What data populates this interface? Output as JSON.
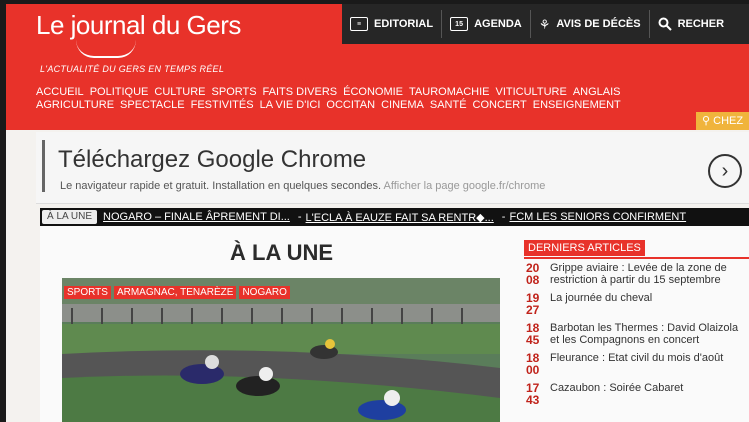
{
  "header": {
    "logo": "Le journal du Gers",
    "tagline": "L'ACTUALITÉ DU GERS EN TEMPS RÉEL",
    "topbar": [
      {
        "label": "EDITORIAL",
        "icon": "newspaper-icon"
      },
      {
        "label": "AGENDA",
        "icon": "calendar-icon",
        "icon_text": "15"
      },
      {
        "label": "AVIS DE DÉCÈS",
        "icon": "flower-icon"
      },
      {
        "label": "RECHER",
        "icon": "search-icon"
      }
    ],
    "nav_row1": [
      "ACCUEIL",
      "POLITIQUE",
      "CULTURE",
      "SPORTS",
      "FAITS DIVERS",
      "ÉCONOMIE",
      "TAUROMACHIE",
      "VITICULTURE",
      "ANGLAIS"
    ],
    "nav_row2": [
      "AGRICULTURE",
      "SPECTACLE",
      "FESTIVITÉS",
      "LA VIE D'ICI",
      "OCCITAN",
      "CINEMA",
      "SANTÉ",
      "CONCERT",
      "ENSEIGNEMENT"
    ],
    "chez": "CHEZ"
  },
  "promo": {
    "title": "Téléchargez Google Chrome",
    "subtitle": "Le navigateur rapide et gratuit. Installation en quelques secondes.",
    "link": "Afficher la page google.fr/chrome"
  },
  "ticker": {
    "label": "À LA UNE",
    "items": [
      "NOGARO – FINALE ÂPREMENT DI...",
      "L'ECLA À EAUZE FAIT SA RENTR◆...",
      "FCM LES SENIORS CONFIRMENT"
    ]
  },
  "main": {
    "title": "À LA UNE",
    "tags": [
      "SPORTS",
      "ARMAGNAC, TENARÈZE",
      "NOGARO"
    ]
  },
  "side": {
    "heading": "DERNIERS ARTICLES",
    "articles": [
      {
        "day": "20",
        "time": "08",
        "title": "Grippe aviaire : Levée de la zone de restriction à partir du 15 septembre"
      },
      {
        "day": "19",
        "time": "27",
        "title": "La journée du cheval"
      },
      {
        "day": "18",
        "time": "45",
        "title": "Barbotan les Thermes : David Olaizola et les Compagnons en concert"
      },
      {
        "day": "18",
        "time": "00",
        "title": "Fleurance : Etat civil du mois d'août"
      },
      {
        "day": "17",
        "time": "43",
        "title": "Cazaubon : Soirée Cabaret"
      }
    ]
  },
  "colors": {
    "brand_red": "#e8322a",
    "topbar_dark": "#262626",
    "chez_yellow": "#f0b43c"
  }
}
